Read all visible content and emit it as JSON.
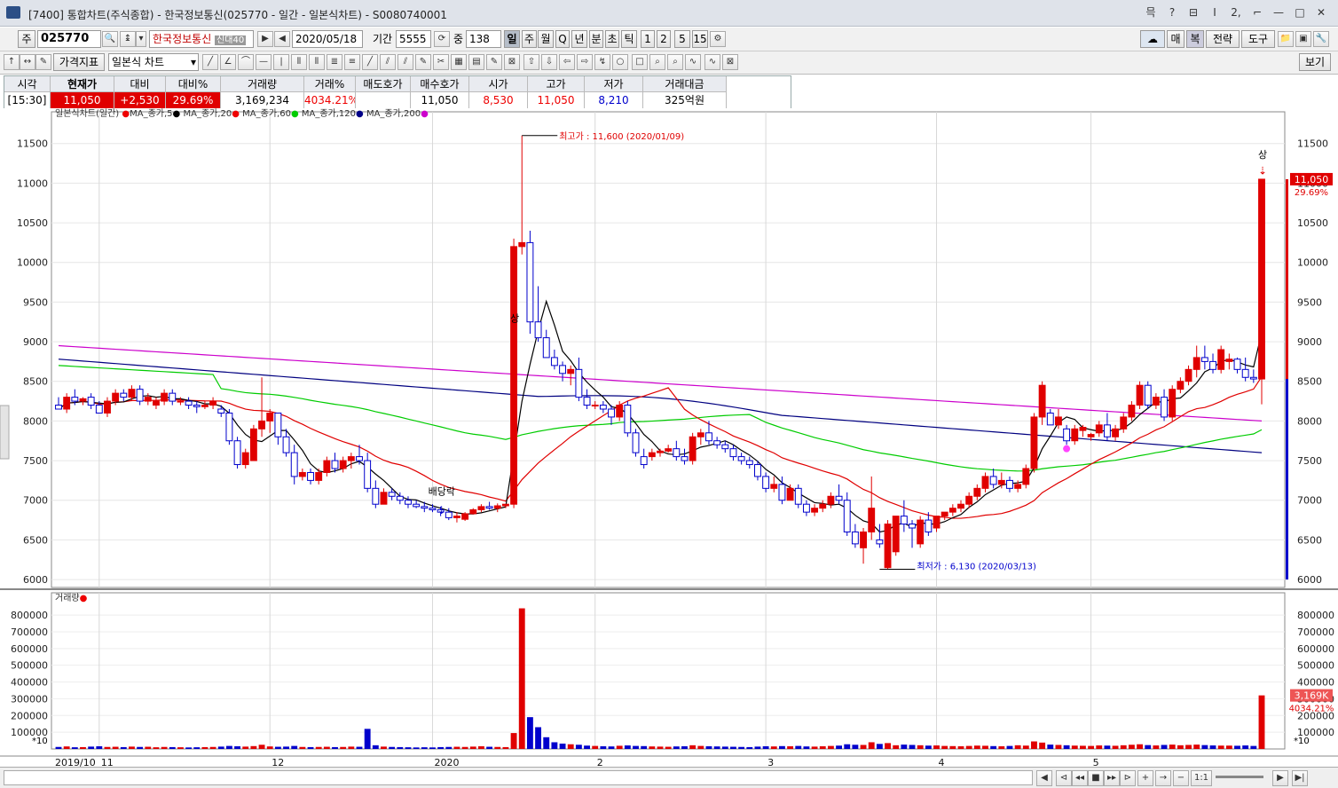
{
  "window": {
    "title": "[7400] 통합차트(주식종합) - 한국정보통신(025770 - 일간 - 일본식차트) - S0080740001",
    "controls": [
      "믁",
      "?",
      "⊟",
      "Ⅰ",
      "2,",
      "⌐",
      "—",
      "□",
      "✕"
    ]
  },
  "toolbar1": {
    "market": "주",
    "code": "025770",
    "stock_name": "한국정보통신",
    "badge": "신대40",
    "date": "2020/05/18",
    "period_label": "기간",
    "period_value": "5555",
    "count_label": "중",
    "count_value": "138",
    "intervals": [
      "일",
      "주",
      "월",
      "Q",
      "년",
      "분",
      "초",
      "틱",
      "1",
      "2",
      "5",
      "15"
    ],
    "right_buttons": [
      "매",
      "복",
      "전략",
      "도구"
    ]
  },
  "toolbar2": {
    "indicator": "가격지표",
    "chart_type": "일본식 차트",
    "view_button": "보기"
  },
  "quote": {
    "headers": [
      "시각",
      "현재가",
      "대비",
      "대비%",
      "거래량",
      "거래%",
      "매도호가",
      "매수호가",
      "시가",
      "고가",
      "저가",
      "거래대금"
    ],
    "values": [
      "[15:30]",
      "11,050",
      "+2,530",
      "29.69%",
      "3,169,234",
      "4034.21%",
      "",
      "11,050",
      "8,530",
      "11,050",
      "8,210",
      "325억원"
    ]
  },
  "legend": {
    "chart": "일본식차트(일간)",
    "ma": [
      {
        "label": "MA_종가,5",
        "color": "#000000"
      },
      {
        "label": "MA_종가,20",
        "color": "#e00000"
      },
      {
        "label": "MA_종가,60",
        "color": "#00cc00"
      },
      {
        "label": "MA_종가,120",
        "color": "#000080"
      },
      {
        "label": "MA_종가,200",
        "color": "#cc00cc"
      }
    ],
    "volume": "거래량"
  },
  "annotations": {
    "high": "최고가 : 11,600 (2020/01/09)",
    "low": "최저가 : 6,130 (2020/03/13)",
    "upper_limit_1": "상",
    "upper_limit_2": "상",
    "dividend": "배당락",
    "price_tag": "11,050",
    "price_pct": "29.69%",
    "vol_tag": "3,169K",
    "vol_pct": "4034.21%",
    "vol_unit": "*10"
  },
  "chart_data": {
    "type": "candlestick",
    "price_ticks": [
      6000,
      6500,
      7000,
      7500,
      8000,
      8500,
      9000,
      9500,
      10000,
      10500,
      11000,
      11500
    ],
    "volume_ticks": [
      100000,
      200000,
      300000,
      400000,
      500000,
      600000,
      700000,
      800000
    ],
    "x_labels": [
      "2019/10",
      "11",
      "12",
      "2020",
      "2",
      "3",
      "4",
      "5"
    ],
    "price_ylim": [
      5900,
      11900
    ],
    "volume_ylim": [
      0,
      880000
    ],
    "candles": [
      [
        8200,
        8300,
        8150,
        8150
      ],
      [
        8150,
        8350,
        8100,
        8300
      ],
      [
        8300,
        8400,
        8200,
        8250
      ],
      [
        8250,
        8300,
        8200,
        8280
      ],
      [
        8300,
        8350,
        8150,
        8200
      ],
      [
        8200,
        8250,
        8100,
        8100
      ],
      [
        8100,
        8300,
        8050,
        8250
      ],
      [
        8250,
        8400,
        8200,
        8350
      ],
      [
        8350,
        8400,
        8250,
        8300
      ],
      [
        8300,
        8450,
        8250,
        8400
      ],
      [
        8400,
        8450,
        8200,
        8250
      ],
      [
        8250,
        8350,
        8200,
        8300
      ],
      [
        8200,
        8300,
        8150,
        8250
      ],
      [
        8250,
        8400,
        8200,
        8350
      ],
      [
        8350,
        8400,
        8200,
        8250
      ],
      [
        8250,
        8300,
        8200,
        8250
      ],
      [
        8250,
        8300,
        8150,
        8200
      ],
      [
        8200,
        8250,
        8100,
        8180
      ],
      [
        8180,
        8250,
        8150,
        8200
      ],
      [
        8200,
        8300,
        8150,
        8250
      ],
      [
        8150,
        8200,
        8050,
        8100
      ],
      [
        8100,
        8150,
        7700,
        7750
      ],
      [
        7750,
        7800,
        7400,
        7450
      ],
      [
        7450,
        7650,
        7400,
        7600
      ],
      [
        7500,
        7950,
        7500,
        7900
      ],
      [
        7900,
        8550,
        7800,
        8000
      ],
      [
        8000,
        8150,
        7850,
        8100
      ],
      [
        8100,
        8100,
        7700,
        7800
      ],
      [
        7800,
        7900,
        7550,
        7600
      ],
      [
        7600,
        7700,
        7200,
        7300
      ],
      [
        7300,
        7400,
        7250,
        7350
      ],
      [
        7350,
        7400,
        7200,
        7250
      ],
      [
        7250,
        7400,
        7200,
        7350
      ],
      [
        7350,
        7550,
        7300,
        7500
      ],
      [
        7500,
        7600,
        7350,
        7400
      ],
      [
        7400,
        7550,
        7350,
        7500
      ],
      [
        7500,
        7600,
        7400,
        7550
      ],
      [
        7550,
        7700,
        7450,
        7500
      ],
      [
        7500,
        7600,
        7100,
        7150
      ],
      [
        7150,
        7250,
        6900,
        6950
      ],
      [
        6950,
        7150,
        6950,
        7100
      ],
      [
        7100,
        7150,
        7000,
        7050
      ],
      [
        7050,
        7100,
        6950,
        7000
      ],
      [
        7000,
        7050,
        6900,
        6950
      ],
      [
        6950,
        7000,
        6900,
        6920
      ],
      [
        6920,
        6980,
        6850,
        6900
      ],
      [
        6900,
        6950,
        6850,
        6880
      ],
      [
        6880,
        6920,
        6800,
        6850
      ],
      [
        6850,
        6900,
        6750,
        6780
      ],
      [
        6780,
        6850,
        6720,
        6800
      ],
      [
        6760,
        6850,
        6740,
        6830
      ],
      [
        6830,
        6900,
        6820,
        6880
      ],
      [
        6880,
        6950,
        6850,
        6920
      ],
      [
        6920,
        6980,
        6880,
        6900
      ],
      [
        6900,
        6960,
        6850,
        6930
      ],
      [
        6930,
        6950,
        6900,
        6950
      ],
      [
        6950,
        10300,
        6900,
        10200
      ],
      [
        10200,
        11600,
        10100,
        10250
      ],
      [
        10250,
        10400,
        9100,
        9250
      ],
      [
        9250,
        9700,
        9000,
        9050
      ],
      [
        9050,
        9150,
        8800,
        8800
      ],
      [
        8800,
        8900,
        8650,
        8700
      ],
      [
        8700,
        8750,
        8500,
        8600
      ],
      [
        8600,
        8700,
        8450,
        8650
      ],
      [
        8650,
        8800,
        8250,
        8300
      ],
      [
        8300,
        8400,
        8150,
        8200
      ],
      [
        8200,
        8250,
        8150,
        8200
      ],
      [
        8200,
        8250,
        8100,
        8150
      ],
      [
        8150,
        8200,
        7950,
        8050
      ],
      [
        8050,
        8250,
        8000,
        8200
      ],
      [
        8200,
        8250,
        7800,
        7850
      ],
      [
        7850,
        7900,
        7550,
        7600
      ],
      [
        7550,
        7650,
        7400,
        7450
      ],
      [
        7550,
        7650,
        7500,
        7600
      ],
      [
        7600,
        7650,
        7550,
        7620
      ],
      [
        7620,
        7700,
        7600,
        7650
      ],
      [
        7650,
        7750,
        7500,
        7550
      ],
      [
        7550,
        7650,
        7450,
        7500
      ],
      [
        7500,
        7850,
        7450,
        7800
      ],
      [
        7800,
        7900,
        7700,
        7850
      ],
      [
        7850,
        8000,
        7700,
        7750
      ],
      [
        7750,
        7800,
        7650,
        7700
      ],
      [
        7700,
        7750,
        7600,
        7650
      ],
      [
        7650,
        7700,
        7500,
        7550
      ],
      [
        7550,
        7600,
        7450,
        7500
      ],
      [
        7500,
        7550,
        7400,
        7450
      ],
      [
        7450,
        7500,
        7250,
        7300
      ],
      [
        7300,
        7350,
        7100,
        7150
      ],
      [
        7150,
        7300,
        7100,
        7200
      ],
      [
        7200,
        7300,
        6950,
        7000
      ],
      [
        7000,
        7200,
        7000,
        7150
      ],
      [
        7150,
        7200,
        6900,
        6950
      ],
      [
        6950,
        7000,
        6800,
        6850
      ],
      [
        6850,
        6950,
        6800,
        6900
      ],
      [
        6900,
        7000,
        6850,
        6950
      ],
      [
        6950,
        7100,
        6900,
        7050
      ],
      [
        7050,
        7200,
        6950,
        7000
      ],
      [
        7000,
        7100,
        6550,
        6600
      ],
      [
        6600,
        6700,
        6400,
        6450
      ],
      [
        6400,
        6650,
        6200,
        6600
      ],
      [
        6600,
        7300,
        6500,
        6900
      ],
      [
        6500,
        6700,
        6400,
        6450
      ],
      [
        6150,
        6750,
        6130,
        6700
      ],
      [
        6350,
        6800,
        6300,
        6800
      ],
      [
        6800,
        7000,
        6600,
        6700
      ],
      [
        6700,
        6750,
        6400,
        6650
      ],
      [
        6450,
        6800,
        6400,
        6750
      ],
      [
        6750,
        6850,
        6550,
        6600
      ],
      [
        6650,
        6800,
        6600,
        6800
      ],
      [
        6800,
        6850,
        6750,
        6850
      ],
      [
        6850,
        6950,
        6800,
        6900
      ],
      [
        6900,
        7000,
        6850,
        6950
      ],
      [
        6950,
        7100,
        6900,
        7050
      ],
      [
        7050,
        7200,
        7000,
        7150
      ],
      [
        7150,
        7350,
        7100,
        7300
      ],
      [
        7300,
        7400,
        7150,
        7200
      ],
      [
        7200,
        7350,
        7150,
        7250
      ],
      [
        7250,
        7300,
        7100,
        7150
      ],
      [
        7150,
        7250,
        7100,
        7200
      ],
      [
        7200,
        7450,
        7150,
        7400
      ],
      [
        7400,
        8100,
        7350,
        8050
      ],
      [
        8050,
        8500,
        7950,
        8450
      ],
      [
        8100,
        8150,
        7950,
        7950
      ],
      [
        7950,
        8150,
        7900,
        8050
      ],
      [
        7900,
        7950,
        7700,
        7750
      ],
      [
        7750,
        7950,
        7700,
        7900
      ],
      [
        7880,
        7950,
        7800,
        7920
      ],
      [
        7800,
        7850,
        7750,
        7830
      ],
      [
        7850,
        8000,
        7800,
        7950
      ],
      [
        7950,
        8100,
        7750,
        7800
      ],
      [
        7800,
        7950,
        7750,
        7900
      ],
      [
        7900,
        8100,
        7850,
        8050
      ],
      [
        8050,
        8250,
        8000,
        8200
      ],
      [
        8200,
        8500,
        8150,
        8450
      ],
      [
        8450,
        8500,
        8150,
        8200
      ],
      [
        8200,
        8350,
        8150,
        8300
      ],
      [
        8300,
        8400,
        8000,
        8050
      ],
      [
        8050,
        8450,
        8000,
        8400
      ],
      [
        8400,
        8550,
        8350,
        8500
      ],
      [
        8500,
        8700,
        8450,
        8650
      ],
      [
        8650,
        8950,
        8550,
        8800
      ],
      [
        8800,
        8950,
        8650,
        8750
      ],
      [
        8750,
        8850,
        8600,
        8650
      ],
      [
        8650,
        8950,
        8600,
        8900
      ],
      [
        8750,
        8850,
        8650,
        8780
      ],
      [
        8780,
        8800,
        8600,
        8650
      ],
      [
        8650,
        8800,
        8500,
        8550
      ],
      [
        8550,
        8650,
        8480,
        8530
      ],
      [
        8530,
        11050,
        8210,
        11050
      ]
    ],
    "volume": [
      12000,
      15000,
      10000,
      11000,
      14000,
      16000,
      12000,
      13000,
      11000,
      14000,
      12000,
      13000,
      10000,
      12000,
      11000,
      10000,
      9000,
      10000,
      11000,
      12000,
      14000,
      18000,
      16000,
      14000,
      17000,
      25000,
      15000,
      13000,
      14000,
      18000,
      12000,
      11000,
      12000,
      13000,
      11000,
      12000,
      14000,
      13000,
      120000,
      22000,
      14000,
      12000,
      11000,
      10000,
      9000,
      10000,
      9000,
      11000,
      12000,
      13000,
      12000,
      14000,
      16000,
      13000,
      12000,
      11000,
      95000,
      840000,
      190000,
      130000,
      70000,
      40000,
      32000,
      28000,
      25000,
      20000,
      18000,
      16000,
      15000,
      19000,
      21000,
      18000,
      17000,
      15000,
      14000,
      13000,
      15000,
      16000,
      22000,
      18000,
      16000,
      15000,
      14000,
      13000,
      12000,
      11000,
      14000,
      16000,
      15000,
      17000,
      16000,
      18000,
      15000,
      14000,
      16000,
      18000,
      20000,
      28000,
      25000,
      24000,
      40000,
      30000,
      35000,
      22000,
      26000,
      24000,
      22000,
      20000,
      21000,
      18000,
      17000,
      16000,
      18000,
      20000,
      19000,
      17000,
      16000,
      18000,
      22000,
      20000,
      45000,
      38000,
      26000,
      24000,
      22000,
      20000,
      19000,
      18000,
      21000,
      20000,
      19000,
      22000,
      25000,
      28000,
      23000,
      21000,
      24000,
      26000,
      22000,
      24000,
      26000,
      23000,
      21000,
      20000,
      20000,
      19000,
      21000,
      18000,
      320000
    ]
  }
}
